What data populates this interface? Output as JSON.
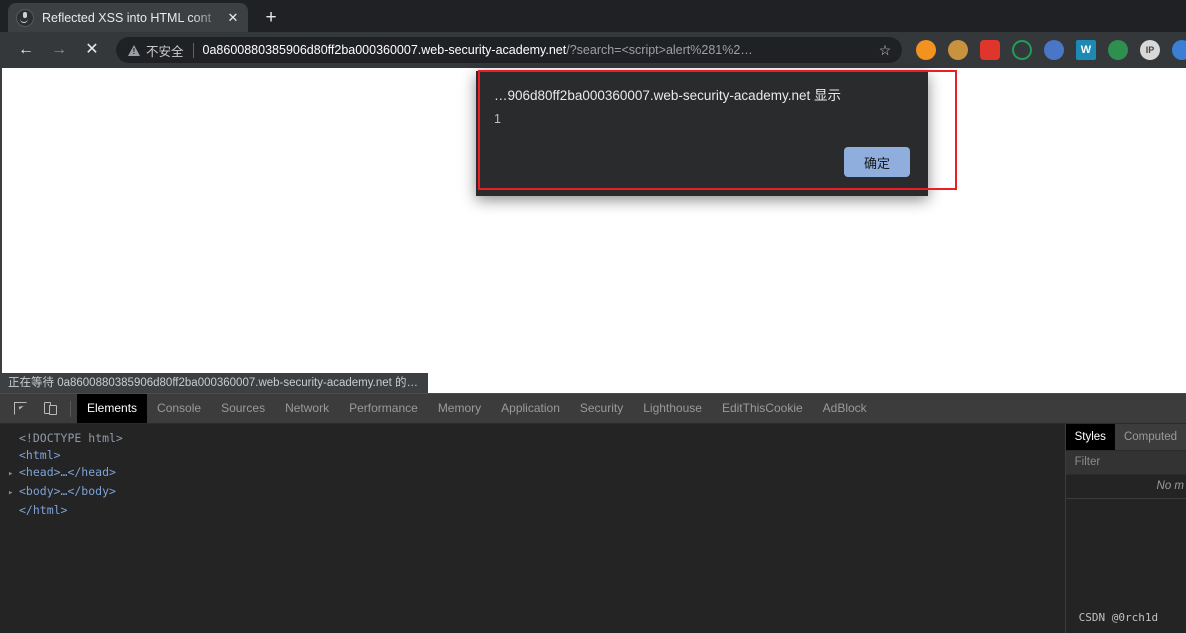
{
  "tab": {
    "title": "Reflected XSS into HTML cont",
    "favicon": "burp-academy-icon",
    "close_label": "✕",
    "newtab_label": "+"
  },
  "toolbar": {
    "back_label": "←",
    "forward_label": "→",
    "stop_label": "✕",
    "security_label": "不安全",
    "url_host": "0a8600880385906d80ff2ba000360007.web-security-academy.net",
    "url_path": "/?search=<script>alert%281%2…",
    "bookmark_label": "☆",
    "extensions": [
      {
        "name": "extension-orange",
        "color": "#f29221",
        "glyph": ""
      },
      {
        "name": "extension-cookie",
        "color": "#c9923e",
        "glyph": ""
      },
      {
        "name": "extension-burp",
        "color": "#e0352b",
        "glyph": ""
      },
      {
        "name": "extension-hexagon",
        "color": "#1f9d55",
        "glyph": ""
      },
      {
        "name": "extension-wappalyzer",
        "color": "#4a76c7",
        "glyph": ""
      },
      {
        "name": "extension-wayback",
        "color": "#1d8ab5",
        "glyph": "W"
      },
      {
        "name": "extension-globe",
        "color": "#2f8f4f",
        "glyph": ""
      },
      {
        "name": "extension-ip",
        "color": "#d8d8d8",
        "glyph": "IP"
      },
      {
        "name": "extension-partial",
        "color": "#3b7fd4",
        "glyph": ""
      }
    ]
  },
  "dialog": {
    "origin": "…906d80ff2ba000360007.web-security-academy.net 显示",
    "message": "1",
    "ok_label": "确定",
    "annotation_color": "#ee1c25"
  },
  "status_bar": {
    "text": "正在等待 0a8600880385906d80ff2ba000360007.web-security-academy.net 的…"
  },
  "devtools": {
    "inspect_icon": "inspect-element-icon",
    "device_icon": "device-toolbar-icon",
    "tabs": [
      {
        "label": "Elements",
        "active": true
      },
      {
        "label": "Console",
        "active": false
      },
      {
        "label": "Sources",
        "active": false
      },
      {
        "label": "Network",
        "active": false
      },
      {
        "label": "Performance",
        "active": false
      },
      {
        "label": "Memory",
        "active": false
      },
      {
        "label": "Application",
        "active": false
      },
      {
        "label": "Security",
        "active": false
      },
      {
        "label": "Lighthouse",
        "active": false
      },
      {
        "label": "EditThisCookie",
        "active": false
      },
      {
        "label": "AdBlock",
        "active": false
      }
    ],
    "dom": [
      {
        "indent": 0,
        "twisty": false,
        "text": "<!DOCTYPE html>",
        "kind": "doctype"
      },
      {
        "indent": 0,
        "twisty": false,
        "text": "<html>",
        "kind": "tag"
      },
      {
        "indent": 0,
        "twisty": true,
        "text": "<head>…</head>",
        "kind": "tag"
      },
      {
        "indent": 0,
        "twisty": true,
        "text": "<body>…</body>",
        "kind": "tag"
      },
      {
        "indent": 0,
        "twisty": false,
        "text": "</html>",
        "kind": "tag"
      }
    ],
    "styles_panel": {
      "tabs": [
        {
          "label": "Styles",
          "active": true
        },
        {
          "label": "Computed",
          "active": false
        }
      ],
      "filter_placeholder": "Filter",
      "empty_text": "No m"
    },
    "watermark": "CSDN @0rch1d"
  }
}
